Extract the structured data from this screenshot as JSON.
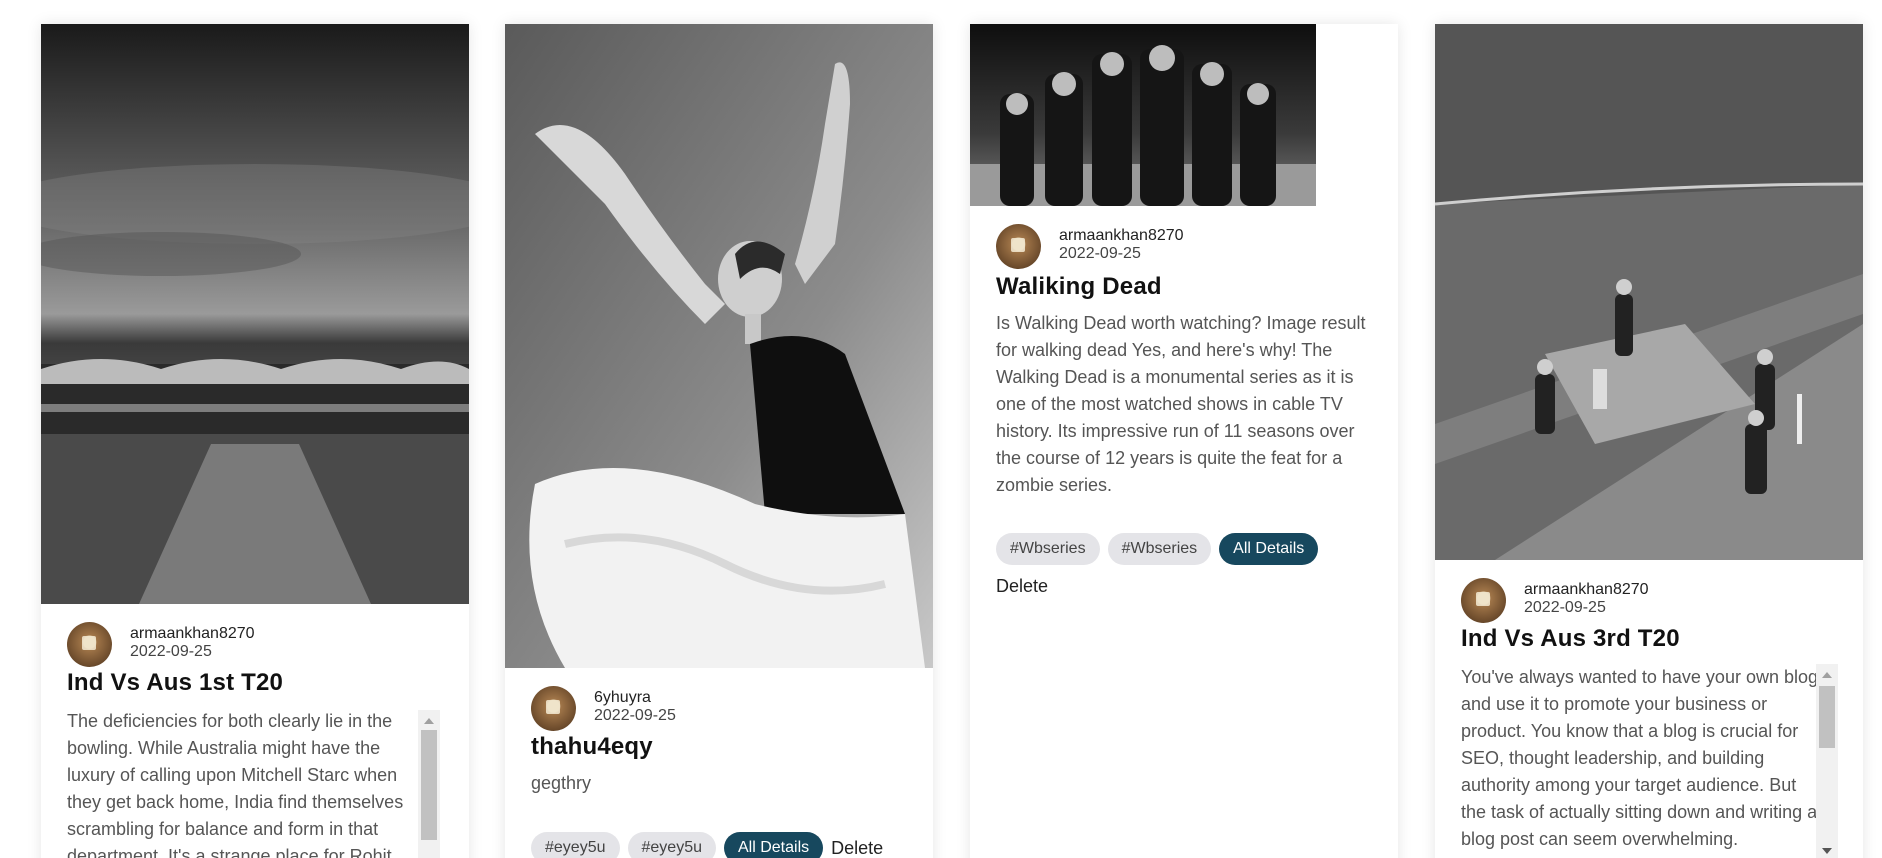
{
  "posts": [
    {
      "image": "cricket stadium at dusk (black and white)",
      "author": "armaankhan8270",
      "date": "2022-09-25",
      "title": "Ind Vs Aus 1st T20",
      "body": "The deficiencies for both clearly lie in the bowling. While Australia might have the luxury of calling upon Mitchell Starc when they get back home, India find themselves scrambling for balance and form in that department. It's a strange place for Rohit"
    },
    {
      "image": "dancer with raised arms in tulle skirt (black and white)",
      "author": "6yhuyra",
      "date": "2022-09-25",
      "title": "thahu4eqy",
      "body": "gegthry",
      "tags": [
        "#eyey5u",
        "#eyey5u"
      ],
      "details_label": "All Details",
      "delete_label": "Delete"
    },
    {
      "image": "walking dead cast group photo (black and white)",
      "author": "armaankhan8270",
      "date": "2022-09-25",
      "title": "Waliking Dead",
      "body": "Is Walking Dead worth watching? Image result for walking dead Yes, and here's why! The Walking Dead is a monumental series as it is one of the most watched shows in cable TV history. Its impressive run of 11 seasons over the course of 12 years is quite the feat for a zombie series.",
      "tags": [
        "#Wbseries",
        "#Wbseries"
      ],
      "details_label": "All Details",
      "delete_label": "Delete"
    },
    {
      "image": "cricket batsman celebrating on pitch (black and white)",
      "author": "armaankhan8270",
      "date": "2022-09-25",
      "title": "Ind Vs Aus 3rd T20",
      "body": "You've always wanted to have your own blog and use it to promote your business or product. You know that a blog is crucial for SEO, thought leadership, and building authority among your target audience. But the task of actually sitting down and writing a blog post can seem overwhelming."
    }
  ],
  "colors": {
    "accent": "#17485e",
    "tag_bg": "#e4e4e8",
    "body_text": "#555555"
  }
}
